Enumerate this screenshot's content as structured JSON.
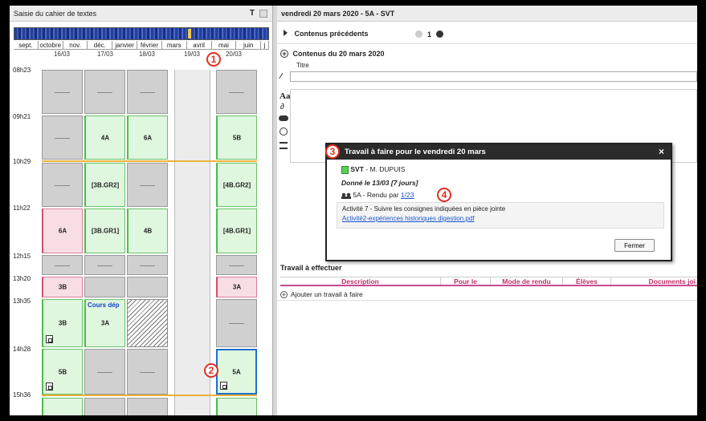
{
  "left": {
    "title": "Saisie du cahier de textes",
    "months": [
      "sept.",
      "octobre",
      "nov.",
      "déc.",
      "janvier",
      "février",
      "mars",
      "avril",
      "mai",
      "juin",
      "j"
    ],
    "days": [
      "16/03",
      "17/03",
      "18/03",
      "19/03",
      "20/03"
    ],
    "times": [
      "08h23",
      "09h21",
      "10h29",
      "11h22",
      "12h15",
      "13h20",
      "13h35",
      "14h28",
      "15h36"
    ],
    "cells": {
      "c4a": "4A",
      "c6a1": "6A",
      "c5b1": "5B",
      "c3bgr2": "[3B.GR2]",
      "c4bgr2": "[4B.GR2]",
      "c6a2": "6A",
      "c3bgr1": "[3B.GR1]",
      "c4b": "4B",
      "c4bgr1": "[4B.GR1]",
      "c3b1": "3B",
      "c3a1": "3A",
      "c3b2": "3B",
      "cdep": "Cours dép",
      "c3a2": "3A",
      "c5b2": "5B",
      "c5a": "5A"
    },
    "markers": {
      "one": "1",
      "two": "2"
    }
  },
  "right": {
    "header": "vendredi 20 mars 2020 - 5A - SVT",
    "prev_label": "Contenus précédents",
    "prev_count": "1",
    "contents_label": "Contenus du 20 mars 2020",
    "title_label": "Titre",
    "title_value": "",
    "work_section": "Travail à effectuer",
    "columns": [
      "Description",
      "Pour le",
      "Mode de rendu",
      "Élèves",
      "Documents joi"
    ],
    "add_work": "Ajouter un travail à faire"
  },
  "popup": {
    "title": "Travail à faire pour le vendredi 20 mars",
    "subject": "SVT",
    "teacher": "- M. DUPUIS",
    "given": "Donné le 13/03 [7 jours]",
    "class_text": "5A - Rendu par",
    "rendu_link": "1/23",
    "activity": "Activité 7 - Suivre les consignes indiquées en pièce jointe",
    "file_link": "Activité2-expériences historiques digestion.pdf",
    "close_button": "Fermer",
    "close_x": "×",
    "marker_three": "3",
    "marker_four": "4"
  },
  "colors": {
    "accent_red": "#e03020",
    "green_cell": "#dff6df",
    "pink_cell": "#f8dde4",
    "selected_border": "#1e6fd0"
  }
}
